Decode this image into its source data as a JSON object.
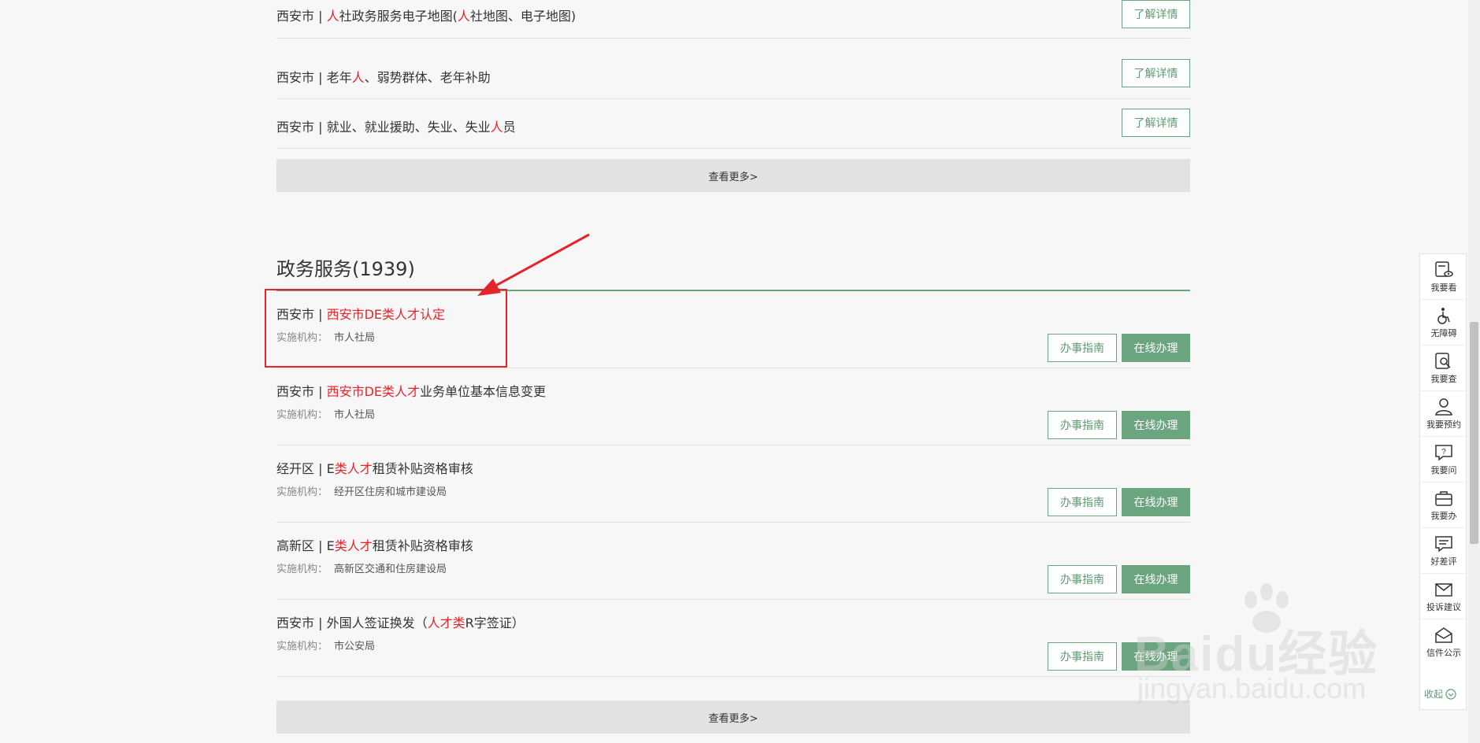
{
  "top_rows": [
    {
      "prefix": "西安市 | ",
      "parts": [
        {
          "t": "人",
          "hl": true
        },
        {
          "t": "社政务服务电子地图(",
          "hl": false
        },
        {
          "t": "人",
          "hl": true
        },
        {
          "t": "社地图、电子地图)",
          "hl": false
        }
      ],
      "button": "了解详情"
    },
    {
      "prefix": "西安市 | ",
      "parts": [
        {
          "t": "老年",
          "hl": false
        },
        {
          "t": "人",
          "hl": true
        },
        {
          "t": "、弱势群体、老年补助",
          "hl": false
        }
      ],
      "button": "了解详情"
    },
    {
      "prefix": "西安市 | ",
      "parts": [
        {
          "t": "就业、就业援助、失业、失业",
          "hl": false
        },
        {
          "t": "人",
          "hl": true
        },
        {
          "t": "员",
          "hl": false
        }
      ],
      "button": "了解详情"
    }
  ],
  "more_label_1": "查看更多>",
  "section": {
    "title": "政务服务(1939)"
  },
  "services": [
    {
      "prefix": "西安市 | ",
      "parts": [
        {
          "t": "西安市DE类人才认定",
          "hl": true
        }
      ],
      "agency_label": "实施机构：",
      "agency": "市人社局"
    },
    {
      "prefix": "西安市 | ",
      "parts": [
        {
          "t": "西安市DE类人才",
          "hl": true
        },
        {
          "t": "业务单位基本信息变更",
          "hl": false
        }
      ],
      "agency_label": "实施机构：",
      "agency": "市人社局"
    },
    {
      "prefix": "经开区 | ",
      "parts": [
        {
          "t": "E",
          "hl": false
        },
        {
          "t": "类人才",
          "hl": true
        },
        {
          "t": "租赁补贴资格审核",
          "hl": false
        }
      ],
      "agency_label": "实施机构：",
      "agency": "经开区住房和城市建设局"
    },
    {
      "prefix": "高新区 | ",
      "parts": [
        {
          "t": "E",
          "hl": false
        },
        {
          "t": "类人才",
          "hl": true
        },
        {
          "t": "租赁补贴资格审核",
          "hl": false
        }
      ],
      "agency_label": "实施机构：",
      "agency": "高新区交通和住房建设局"
    },
    {
      "prefix": "西安市 | ",
      "parts": [
        {
          "t": "外国人签证换发（",
          "hl": false
        },
        {
          "t": "人才类",
          "hl": true
        },
        {
          "t": "R字签证）",
          "hl": false
        }
      ],
      "agency_label": "实施机构：",
      "agency": "市公安局"
    }
  ],
  "service_buttons": {
    "guide": "办事指南",
    "online": "在线办理"
  },
  "more_label_2": "查看更多>",
  "sidebar": [
    {
      "label": "我要看",
      "icon": "eye-doc-icon"
    },
    {
      "label": "无障碍",
      "icon": "wheelchair-icon"
    },
    {
      "label": "我要查",
      "icon": "search-doc-icon"
    },
    {
      "label": "我要预约",
      "icon": "user-icon"
    },
    {
      "label": "我要问",
      "icon": "question-bubble-icon"
    },
    {
      "label": "我要办",
      "icon": "briefcase-icon"
    },
    {
      "label": "好差评",
      "icon": "comment-icon"
    },
    {
      "label": "投诉建议",
      "icon": "mail-icon"
    },
    {
      "label": "信件公示",
      "icon": "open-mail-icon"
    }
  ],
  "collapse_label": "收起",
  "watermark": {
    "main": "Baidu经验",
    "sub": "jingyan.baidu.com"
  },
  "colors": {
    "accent": "#6aa57f",
    "highlight": "#e4242a"
  }
}
